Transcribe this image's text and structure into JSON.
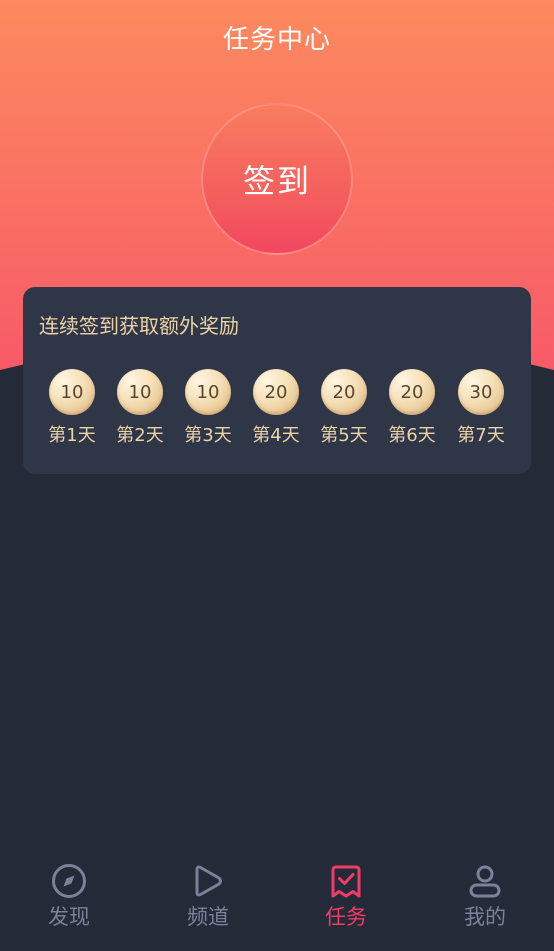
{
  "header": {
    "title": "任务中心"
  },
  "checkin": {
    "label": "签到"
  },
  "streak": {
    "title": "连续签到获取额外奖励",
    "days": [
      {
        "reward": "10",
        "label": "第1天"
      },
      {
        "reward": "10",
        "label": "第2天"
      },
      {
        "reward": "10",
        "label": "第3天"
      },
      {
        "reward": "20",
        "label": "第4天"
      },
      {
        "reward": "20",
        "label": "第5天"
      },
      {
        "reward": "20",
        "label": "第6天"
      },
      {
        "reward": "30",
        "label": "第7天"
      }
    ]
  },
  "nav": {
    "items": [
      {
        "label": "发现",
        "icon": "compass-icon",
        "active": false
      },
      {
        "label": "频道",
        "icon": "play-icon",
        "active": false
      },
      {
        "label": "任务",
        "icon": "task-check-icon",
        "active": true
      },
      {
        "label": "我的",
        "icon": "user-icon",
        "active": false
      }
    ]
  },
  "colors": {
    "hero_top": "#fc8a5e",
    "hero_bottom": "#f75a68",
    "background": "#242a38",
    "card": "#2f3647",
    "gold_text": "#ecd3a6",
    "nav_active": "#f03c64",
    "nav_inactive": "#7b8198"
  }
}
